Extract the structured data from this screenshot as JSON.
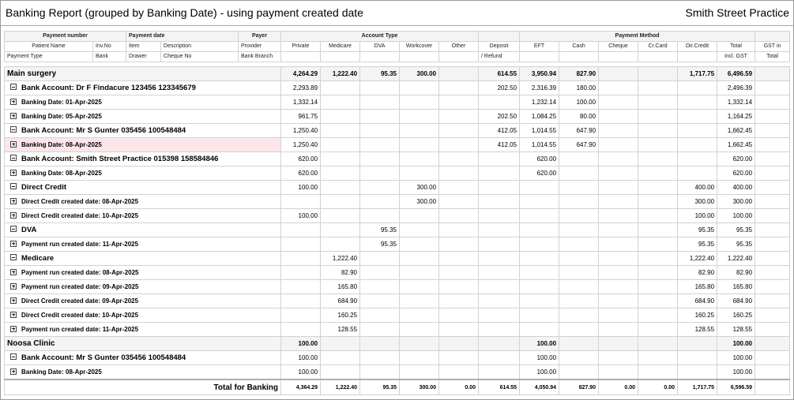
{
  "header": {
    "title": "Banking Report (grouped by Banking Date) - using payment created date",
    "practice": "Smith Street Practice"
  },
  "columns": {
    "row1": {
      "payment_number": "Payment number",
      "payment_date": "Payment date",
      "payer": "Payer",
      "account_type": "Account Type",
      "payment_method": "Payment Method"
    },
    "row2": {
      "patient_name": "Patient Name",
      "inv_no": "Inv.No",
      "item": "Item",
      "description": "Description",
      "provider": "Provider",
      "private": "Private",
      "medicare": "Medicare",
      "dva": "DVA",
      "workcover": "Workcover",
      "other": "Other",
      "deposit": "Deposit",
      "eft": "EFT",
      "cash": "Cash",
      "cheque": "Cheque",
      "cr_card": "Cr.Card",
      "dir_credit": "Dir.Credit",
      "total": "Total",
      "gst_in": "GST in"
    },
    "row3": {
      "payment_type": "Payment Type",
      "bank": "Bank",
      "drawer": "Drawer",
      "cheque_no": "Cheque No",
      "bank_branch": "Bank Branch",
      "refund": "/ Refund",
      "incl_gst": "incl. GST",
      "total": "Total"
    }
  },
  "rows": [
    {
      "level": 1,
      "label": "Main surgery",
      "toggle": "",
      "v": [
        "4,264.29",
        "1,222.40",
        "95.35",
        "300.00",
        "",
        "614.55",
        "3,950.94",
        "827.90",
        "",
        "",
        "1,717.75",
        "6,496.59",
        ""
      ]
    },
    {
      "level": 2,
      "label": "Bank Account: Dr F Findacure 123456 123345679",
      "toggle": "minus",
      "v": [
        "2,293.89",
        "",
        "",
        "",
        "",
        "202.50",
        "2,316.39",
        "180.00",
        "",
        "",
        "",
        "2,496.39",
        ""
      ]
    },
    {
      "level": 3,
      "label": "Banking Date: 01-Apr-2025",
      "toggle": "plus",
      "v": [
        "1,332.14",
        "",
        "",
        "",
        "",
        "",
        "1,232.14",
        "100.00",
        "",
        "",
        "",
        "1,332.14",
        ""
      ]
    },
    {
      "level": 3,
      "label": "Banking Date: 05-Apr-2025",
      "toggle": "plus",
      "v": [
        "961.75",
        "",
        "",
        "",
        "",
        "202.50",
        "1,084.25",
        "80.00",
        "",
        "",
        "",
        "1,164.25",
        ""
      ]
    },
    {
      "level": 2,
      "label": "Bank Account: Mr S Gunter 035456 100548484",
      "toggle": "minus",
      "v": [
        "1,250.40",
        "",
        "",
        "",
        "",
        "412.05",
        "1,014.55",
        "647.90",
        "",
        "",
        "",
        "1,662.45",
        ""
      ]
    },
    {
      "level": 3,
      "label": "Banking Date: 08-Apr-2025",
      "toggle": "plus",
      "selected": true,
      "v": [
        "1,250.40",
        "",
        "",
        "",
        "",
        "412.05",
        "1,014.55",
        "647.90",
        "",
        "",
        "",
        "1,662.45",
        ""
      ]
    },
    {
      "level": 2,
      "label": "Bank Account: Smith Street Practice 015398 158584846",
      "toggle": "minus",
      "v": [
        "620.00",
        "",
        "",
        "",
        "",
        "",
        "620.00",
        "",
        "",
        "",
        "",
        "620.00",
        ""
      ]
    },
    {
      "level": 3,
      "label": "Banking Date: 08-Apr-2025",
      "toggle": "plus",
      "v": [
        "620.00",
        "",
        "",
        "",
        "",
        "",
        "620.00",
        "",
        "",
        "",
        "",
        "620.00",
        ""
      ]
    },
    {
      "level": 2,
      "label": "Direct Credit",
      "toggle": "minus",
      "v": [
        "100.00",
        "",
        "",
        "300.00",
        "",
        "",
        "",
        "",
        "",
        "",
        "400.00",
        "400.00",
        ""
      ]
    },
    {
      "level": 3,
      "label": "Direct Credit created date: 08-Apr-2025",
      "toggle": "plus",
      "v": [
        "",
        "",
        "",
        "300.00",
        "",
        "",
        "",
        "",
        "",
        "",
        "300.00",
        "300.00",
        ""
      ]
    },
    {
      "level": 3,
      "label": "Direct Credit created date: 10-Apr-2025",
      "toggle": "plus",
      "v": [
        "100.00",
        "",
        "",
        "",
        "",
        "",
        "",
        "",
        "",
        "",
        "100.00",
        "100.00",
        ""
      ]
    },
    {
      "level": 2,
      "label": "DVA",
      "toggle": "minus",
      "v": [
        "",
        "",
        "95.35",
        "",
        "",
        "",
        "",
        "",
        "",
        "",
        "95.35",
        "95.35",
        ""
      ]
    },
    {
      "level": 3,
      "label": "Payment run created date: 11-Apr-2025",
      "toggle": "plus",
      "v": [
        "",
        "",
        "95.35",
        "",
        "",
        "",
        "",
        "",
        "",
        "",
        "95.35",
        "95.35",
        ""
      ]
    },
    {
      "level": 2,
      "label": "Medicare",
      "toggle": "minus",
      "v": [
        "",
        "1,222.40",
        "",
        "",
        "",
        "",
        "",
        "",
        "",
        "",
        "1,222.40",
        "1,222.40",
        ""
      ]
    },
    {
      "level": 3,
      "label": "Payment run created date: 08-Apr-2025",
      "toggle": "plus",
      "v": [
        "",
        "82.90",
        "",
        "",
        "",
        "",
        "",
        "",
        "",
        "",
        "82.90",
        "82.90",
        ""
      ]
    },
    {
      "level": 3,
      "label": "Payment run created date: 09-Apr-2025",
      "toggle": "plus",
      "v": [
        "",
        "165.80",
        "",
        "",
        "",
        "",
        "",
        "",
        "",
        "",
        "165.80",
        "165.80",
        ""
      ]
    },
    {
      "level": 3,
      "label": "Direct Credit created date: 09-Apr-2025",
      "toggle": "plus",
      "v": [
        "",
        "684.90",
        "",
        "",
        "",
        "",
        "",
        "",
        "",
        "",
        "684.90",
        "684.90",
        ""
      ]
    },
    {
      "level": 3,
      "label": "Direct Credit created date: 10-Apr-2025",
      "toggle": "plus",
      "v": [
        "",
        "160.25",
        "",
        "",
        "",
        "",
        "",
        "",
        "",
        "",
        "160.25",
        "160.25",
        ""
      ]
    },
    {
      "level": 3,
      "label": "Payment run created date: 11-Apr-2025",
      "toggle": "plus",
      "v": [
        "",
        "128.55",
        "",
        "",
        "",
        "",
        "",
        "",
        "",
        "",
        "128.55",
        "128.55",
        ""
      ]
    },
    {
      "level": 1,
      "label": "Noosa Clinic",
      "toggle": "",
      "v": [
        "100.00",
        "",
        "",
        "",
        "",
        "",
        "100.00",
        "",
        "",
        "",
        "",
        "100.00",
        ""
      ]
    },
    {
      "level": 2,
      "label": "Bank Account: Mr S Gunter 035456 100548484",
      "toggle": "minus",
      "v": [
        "100.00",
        "",
        "",
        "",
        "",
        "",
        "100.00",
        "",
        "",
        "",
        "",
        "100.00",
        ""
      ]
    },
    {
      "level": 3,
      "label": "Banking Date: 08-Apr-2025",
      "toggle": "plus",
      "v": [
        "100.00",
        "",
        "",
        "",
        "",
        "",
        "100.00",
        "",
        "",
        "",
        "",
        "100.00",
        ""
      ]
    }
  ],
  "total": {
    "label": "Total for Banking",
    "v": [
      "4,364.29",
      "1,222.40",
      "95.35",
      "300.00",
      "0.00",
      "614.55",
      "4,050.94",
      "827.90",
      "0.00",
      "0.00",
      "1,717.75",
      "6,596.59",
      ""
    ]
  }
}
